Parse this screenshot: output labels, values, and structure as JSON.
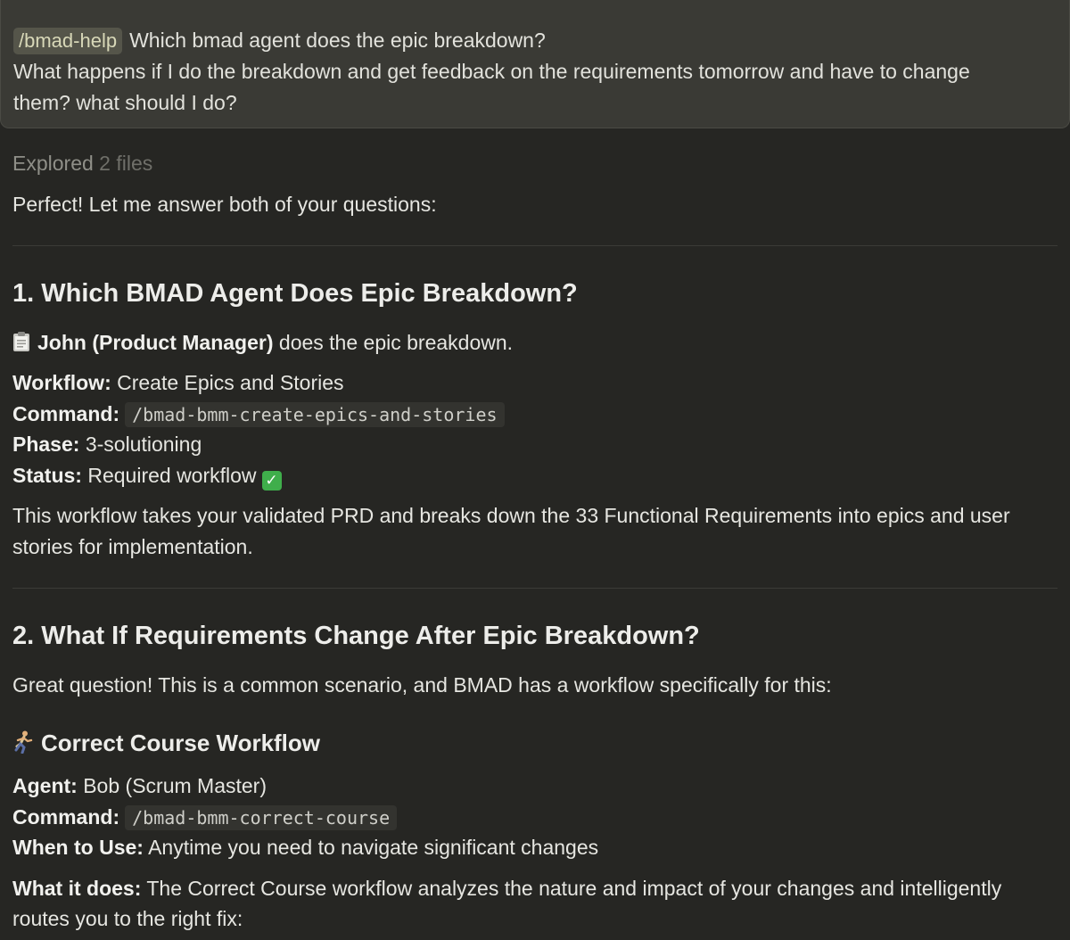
{
  "user_message": {
    "command": "/bmad-help",
    "line1": "Which bmad agent does the epic breakdown?",
    "line2": "What happens if I do the breakdown and get feedback on the requirements tomorrow and have to change",
    "line3": "them? what should I do?"
  },
  "explored": {
    "label": "Explored",
    "count": "2 files"
  },
  "intro": "Perfect! Let me answer both of your questions:",
  "section1": {
    "heading": "1. Which BMAD Agent Does Epic Breakdown?",
    "agent_name": "John (Product Manager)",
    "agent_suffix": " does the epic breakdown.",
    "workflow_label": "Workflow:",
    "workflow_value": " Create Epics and Stories",
    "command_label": "Command:",
    "command_value": "/bmad-bmm-create-epics-and-stories",
    "phase_label": "Phase:",
    "phase_value": " 3-solutioning",
    "status_label": "Status:",
    "status_value": " Required workflow",
    "description_line1": "This workflow takes your validated PRD and breaks down the 33 Functional Requirements into epics and user",
    "description_line2": "stories for implementation."
  },
  "section2": {
    "heading": "2. What If Requirements Change After Epic Breakdown?",
    "intro": "Great question! This is a common scenario, and BMAD has a workflow specifically for this:",
    "subheading": "Correct Course Workflow",
    "agent_label": "Agent:",
    "agent_value": " Bob (Scrum Master)",
    "command_label": "Command:",
    "command_value": "/bmad-bmm-correct-course",
    "when_label": "When to Use:",
    "when_value": " Anytime you need to navigate significant changes",
    "what_label": "What it does:",
    "what_value_line1": " The Correct Course workflow analyzes the nature and impact of your changes and intelligently",
    "what_value_line2": "routes you to the right fix:"
  },
  "icons": {
    "clipboard": "clipboard-icon",
    "check": "check-mark-icon",
    "runner": "running-person-icon"
  },
  "colors": {
    "background": "#262623",
    "user_bubble": "#3a3a35",
    "check_green": "#3fae4b"
  }
}
